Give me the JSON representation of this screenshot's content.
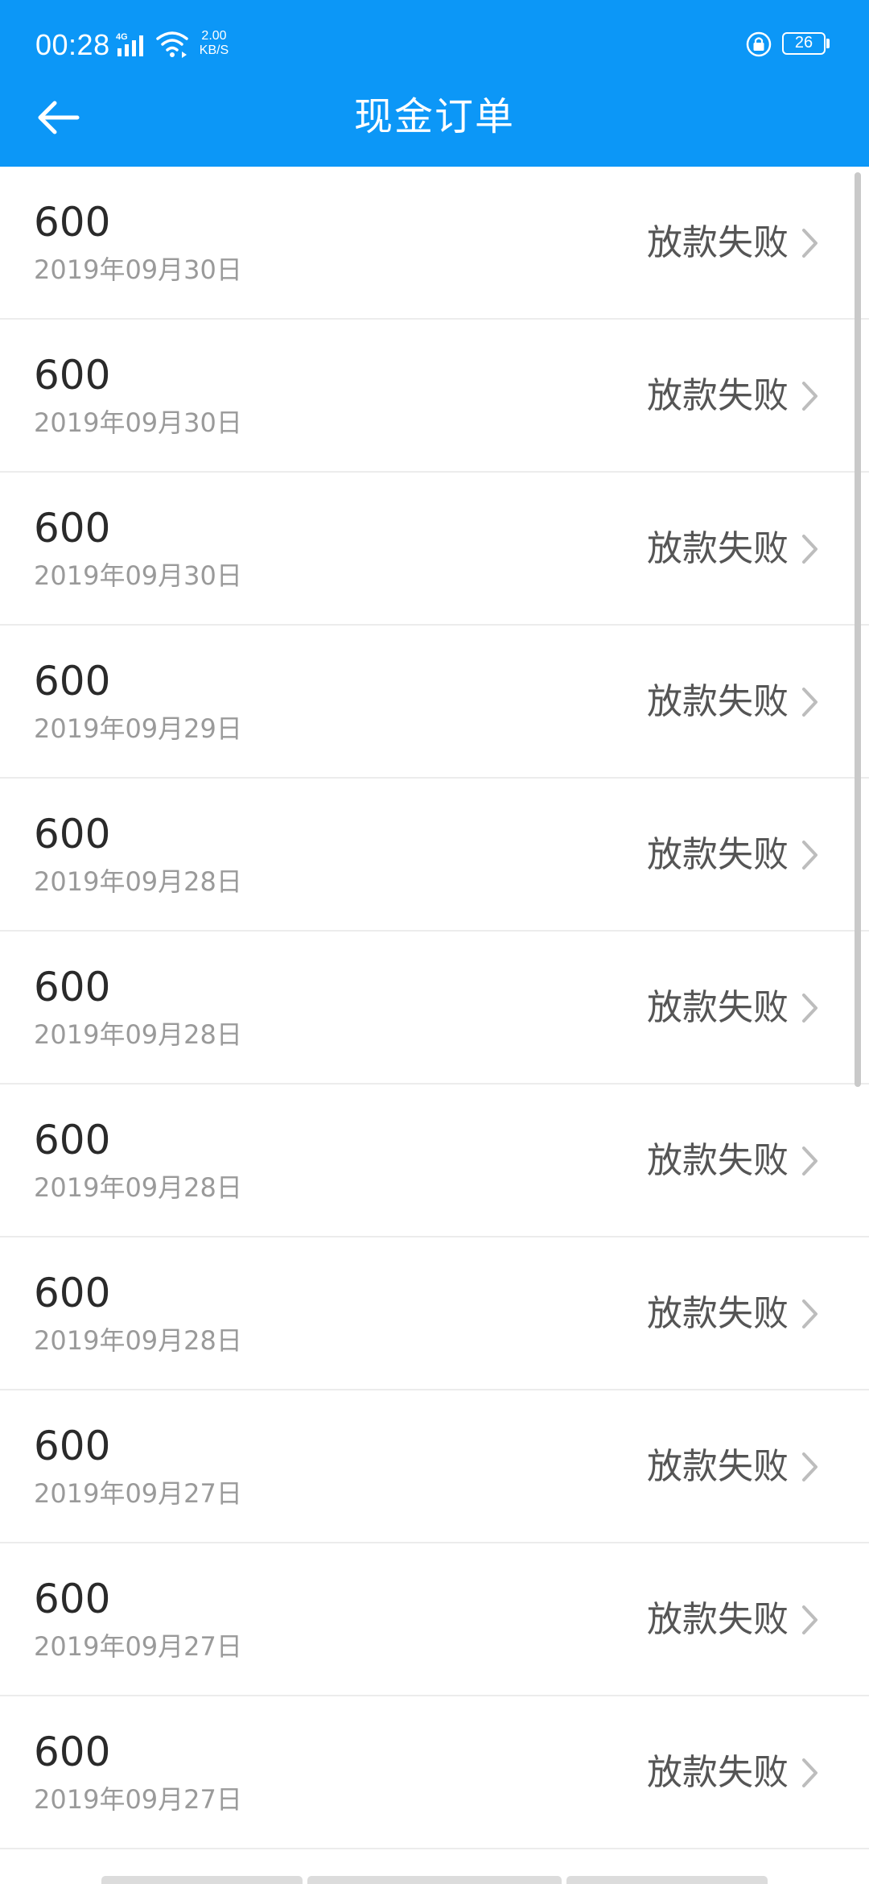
{
  "status_bar": {
    "time": "00:28",
    "net_speed_value": "2.00",
    "net_speed_unit": "KB/S",
    "battery_level": "26"
  },
  "header": {
    "title": "现金订单",
    "background_color": "#0c97f7"
  },
  "icons": {
    "back": "arrow-left-icon",
    "row_chevron": "chevron-right-icon"
  },
  "orders": [
    {
      "amount": "600",
      "date": "2019年09月30日",
      "status": "放款失败"
    },
    {
      "amount": "600",
      "date": "2019年09月30日",
      "status": "放款失败"
    },
    {
      "amount": "600",
      "date": "2019年09月30日",
      "status": "放款失败"
    },
    {
      "amount": "600",
      "date": "2019年09月29日",
      "status": "放款失败"
    },
    {
      "amount": "600",
      "date": "2019年09月28日",
      "status": "放款失败"
    },
    {
      "amount": "600",
      "date": "2019年09月28日",
      "status": "放款失败"
    },
    {
      "amount": "600",
      "date": "2019年09月28日",
      "status": "放款失败"
    },
    {
      "amount": "600",
      "date": "2019年09月28日",
      "status": "放款失败"
    },
    {
      "amount": "600",
      "date": "2019年09月27日",
      "status": "放款失败"
    },
    {
      "amount": "600",
      "date": "2019年09月27日",
      "status": "放款失败"
    },
    {
      "amount": "600",
      "date": "2019年09月27日",
      "status": "放款失败"
    }
  ]
}
